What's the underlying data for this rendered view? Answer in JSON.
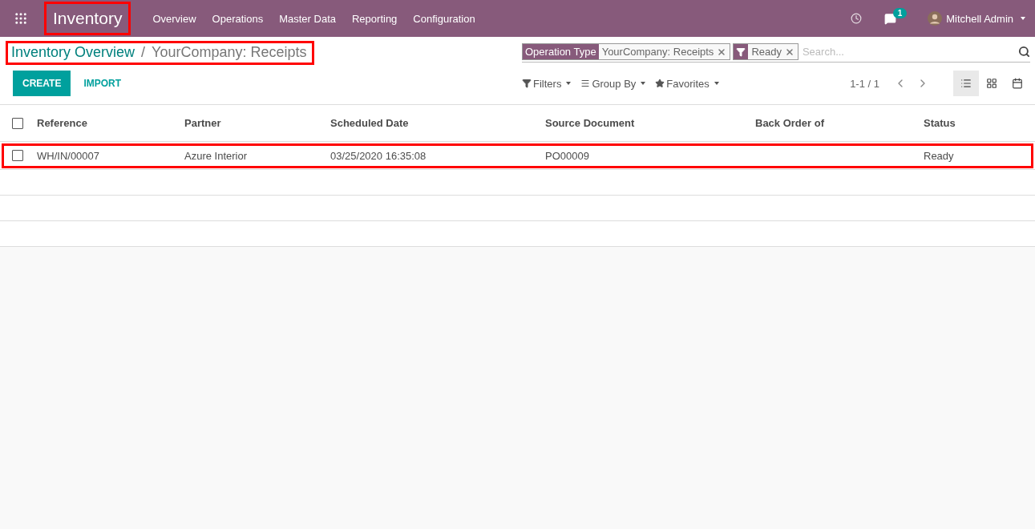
{
  "navbar": {
    "app_name": "Inventory",
    "app_name_highlighted": true,
    "menu": [
      "Overview",
      "Operations",
      "Master Data",
      "Reporting",
      "Configuration"
    ],
    "message_count": "1",
    "user": "Mitchell Admin"
  },
  "breadcrumb": {
    "highlighted": true,
    "separator": "/",
    "items": [
      {
        "label": "Inventory Overview",
        "kind": "link"
      },
      {
        "label": "YourCompany: Receipts",
        "kind": "current"
      }
    ]
  },
  "buttons": [
    {
      "label": "CREATE",
      "kind": "primary"
    },
    {
      "label": "IMPORT",
      "kind": "link"
    }
  ],
  "search": {
    "placeholder": "Search...",
    "facets": [
      {
        "kind": "field",
        "label": "Operation Type",
        "value": "YourCompany: Receipts"
      },
      {
        "kind": "filter",
        "value": "Ready"
      }
    ]
  },
  "search_options": [
    "Filters",
    "Group By",
    "Favorites"
  ],
  "pager": "1-1 / 1",
  "views": [
    {
      "kind": "list",
      "selected": true
    },
    {
      "kind": "kanban",
      "selected": false
    },
    {
      "kind": "calendar",
      "selected": false
    }
  ],
  "table": {
    "select_all_checked": false,
    "columns": [
      "Reference",
      "Partner",
      "Scheduled Date",
      "Source Document",
      "Back Order of",
      "Status"
    ],
    "rows": [
      {
        "checked": false,
        "highlighted": true,
        "cells": [
          "WH/IN/00007",
          "Azure Interior",
          "03/25/2020 16:35:08",
          "PO00009",
          "",
          "Ready"
        ]
      }
    ]
  }
}
